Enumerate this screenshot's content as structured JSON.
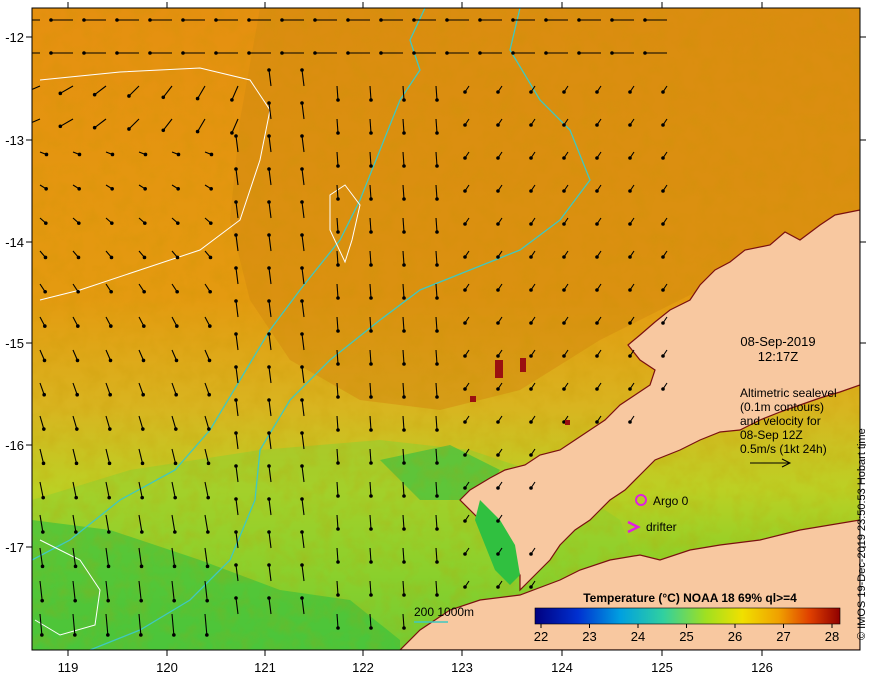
{
  "map": {
    "date": "08-Sep-2019",
    "time": "12:17Z",
    "altimetry_lines": [
      "Altimetric sealevel",
      "(0.1m contours)",
      "and velocity for",
      "08-Sep 12Z",
      "0.5m/s (1kt 24h)"
    ],
    "legend": {
      "argo_label": "Argo 0",
      "drifter_label": "drifter",
      "bathymetry_label": "200 1000m",
      "colorbar_title": "Temperature (°C) NOAA 18 69% ql>=4",
      "colorbar_ticks": [
        "22",
        "23",
        "24",
        "25",
        "26",
        "27",
        "28"
      ]
    },
    "axes": {
      "x_ticks": [
        "119",
        "120",
        "121",
        "122",
        "123",
        "124",
        "125",
        "126"
      ],
      "y_ticks": [
        "-12",
        "-13",
        "-14",
        "-15",
        "-16",
        "-17"
      ]
    },
    "credit": "© IMOS 19-Dec-2019 23:50:53 Hobart time",
    "colors": {
      "land": "#f8c8a0",
      "ocean_warm": "#e89a10",
      "ocean_cool": "#9ad020",
      "ocean_coolest": "#10c040",
      "bathymetry_contour": "#40c8c0",
      "sealevel_contour": "#ffffff",
      "argo_marker": "#e020e0",
      "drifter_marker": "#e020e0"
    }
  }
}
